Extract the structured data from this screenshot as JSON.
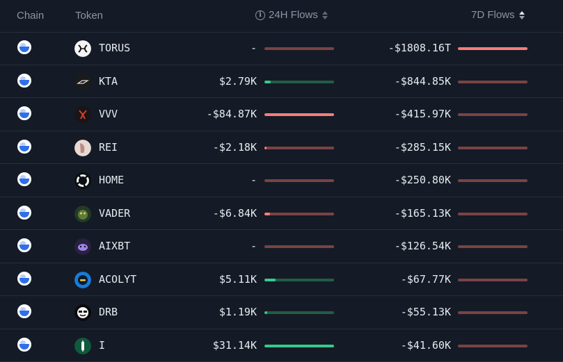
{
  "header": {
    "chain": "Chain",
    "token": "Token",
    "flows_24h": "24H Flows",
    "flows_7d": "7D Flows",
    "info_icon": "i"
  },
  "colors": {
    "negative_fill": "#ff7b7b",
    "negative_track": "#7a4343",
    "positive_fill": "#38c98a",
    "positive_track": "#245c45"
  },
  "rows": [
    {
      "token": "TORUS",
      "logo": "torus-logo",
      "flow24": "-",
      "bar24": {
        "sign": "neg",
        "level": 0
      },
      "flow7d": "-$1808.16T",
      "bar7d": {
        "sign": "neg",
        "level": 1.0
      }
    },
    {
      "token": "KTA",
      "logo": "kta-logo",
      "flow24": "$2.79K",
      "bar24": {
        "sign": "pos",
        "level": 0.09
      },
      "flow7d": "-$844.85K",
      "bar7d": {
        "sign": "neg",
        "level": 0
      }
    },
    {
      "token": "VVV",
      "logo": "vvv-logo",
      "flow24": "-$84.87K",
      "bar24": {
        "sign": "neg",
        "level": 1.0
      },
      "flow7d": "-$415.97K",
      "bar7d": {
        "sign": "neg",
        "level": 0
      }
    },
    {
      "token": "REI",
      "logo": "rei-logo",
      "flow24": "-$2.18K",
      "bar24": {
        "sign": "neg",
        "level": 0.03
      },
      "flow7d": "-$285.15K",
      "bar7d": {
        "sign": "neg",
        "level": 0
      }
    },
    {
      "token": "HOME",
      "logo": "home-logo",
      "flow24": "-",
      "bar24": {
        "sign": "neg",
        "level": 0
      },
      "flow7d": "-$250.80K",
      "bar7d": {
        "sign": "neg",
        "level": 0
      }
    },
    {
      "token": "VADER",
      "logo": "vader-logo",
      "flow24": "-$6.84K",
      "bar24": {
        "sign": "neg",
        "level": 0.08
      },
      "flow7d": "-$165.13K",
      "bar7d": {
        "sign": "neg",
        "level": 0
      }
    },
    {
      "token": "AIXBT",
      "logo": "aixbt-logo",
      "flow24": "-",
      "bar24": {
        "sign": "neg",
        "level": 0
      },
      "flow7d": "-$126.54K",
      "bar7d": {
        "sign": "neg",
        "level": 0
      }
    },
    {
      "token": "ACOLYT",
      "logo": "acolyt-logo",
      "flow24": "$5.11K",
      "bar24": {
        "sign": "pos",
        "level": 0.16
      },
      "flow7d": "-$67.77K",
      "bar7d": {
        "sign": "neg",
        "level": 0
      }
    },
    {
      "token": "DRB",
      "logo": "drb-logo",
      "flow24": "$1.19K",
      "bar24": {
        "sign": "pos",
        "level": 0.04
      },
      "flow7d": "-$55.13K",
      "bar7d": {
        "sign": "neg",
        "level": 0
      }
    },
    {
      "token": "I",
      "logo": "i-logo",
      "flow24": "$31.14K",
      "bar24": {
        "sign": "pos",
        "level": 1.0
      },
      "flow7d": "-$41.60K",
      "bar7d": {
        "sign": "neg",
        "level": 0
      }
    }
  ]
}
